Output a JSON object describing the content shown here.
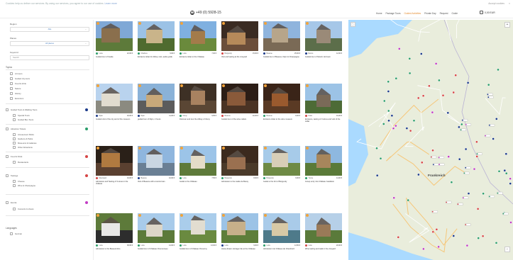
{
  "topbar": {
    "notice": "Cookies help us deliver our services. By using our services, you agree to our use of cookies.",
    "link": "Learn more",
    "right_text": "Accept cookies",
    "close": "×"
  },
  "header": {
    "phone": "+49 (0) 5928-15",
    "nav": [
      "Home",
      "Package Tours",
      "Guided Activities",
      "Private Day",
      "Request",
      "Guide"
    ],
    "nav_active_index": 2,
    "cart": "0,00 EUR"
  },
  "sidebar": {
    "region_label": "Region",
    "region_value": "Alle",
    "place_label": "Places",
    "place_value": "All places",
    "keyword_label": "Keyword",
    "keyword_placeholder": "Search",
    "topics_title": "Topics",
    "topics": [
      "Art tours",
      "Guided city tours",
      "Food & drink",
      "Nature",
      "History",
      "Excursion"
    ],
    "group_tours": "Guided Tours & Walking Tours",
    "group_tours_items": [
      "Special Tours",
      "Guided Bus Tours"
    ],
    "attractions": "Attraction Tickets",
    "attractions_items": [
      "Amusement Parks",
      "Gardens & Parks",
      "Museums & Galleries",
      "Other Attractions"
    ],
    "food": "Food & Drink",
    "food_items": [
      "Restaurants"
    ],
    "tastings": "Tastings",
    "tastings_items": [
      "Cheese",
      "Wine & Champagne"
    ],
    "events": "Events",
    "events_items": [
      "Concerts & shows"
    ],
    "languages_title": "Languages",
    "languages_items": [
      "German"
    ],
    "colors": {
      "group_dot": "#1b3a8a",
      "attract_dot": "#2a9d6a",
      "food_dot": "#d64545",
      "tast_dot": "#d64545",
      "event_dot": "#c23cc4"
    }
  },
  "cards": [
    {
      "title": "Guided tour of Castle",
      "loc": "Loire",
      "price": "22,00 €",
      "color": "#2a9d6a"
    },
    {
      "title": "Entrance ticket for Abbey visit, audio guide",
      "loc": "Chartres",
      "price": "9,00 €",
      "color": "#2a9d6a"
    },
    {
      "title": "Entrance ticket to the Château",
      "loc": "Loire",
      "price": "7,00 €",
      "color": "#2a9d6a"
    },
    {
      "title": "Visit and tasting at the vineyard",
      "loc": "Burgundy",
      "price": "15,00 €",
      "color": "#d64545"
    },
    {
      "title": "Guided tour of Beaune, Dijon & Champagne",
      "loc": "Beaune",
      "price": "25,00 €",
      "color": "#1b3a8a"
    },
    {
      "title": "Guided tour of historic old town",
      "loc": "Reims",
      "price": "12,00 €",
      "color": "#1b3a8a"
    },
    {
      "title": "Guided visit of the city and of the museum",
      "loc": "Dijon",
      "price": "18,00 €",
      "color": "#1b3a8a"
    },
    {
      "title": "guided tour of Dijon, 2 hours",
      "loc": "Dijon",
      "price": "11,00 €",
      "color": "#1b3a8a"
    },
    {
      "title": "Discover and tour the Abbey of Cluny",
      "loc": "Cluny",
      "price": "9,50 €",
      "color": "#2a9d6a"
    },
    {
      "title": "Guided tour of the wine cellars",
      "loc": "Beaune",
      "price": "22,00 €",
      "color": "#d64545"
    },
    {
      "title": "Entrance ticket to the wine museum",
      "loc": "Beaune",
      "price": "8,00 €",
      "color": "#2a9d6a"
    },
    {
      "title": "Entrance, tasting of 3 wines and visit of the cellar",
      "loc": "Nuits",
      "price": "16,00 €",
      "color": "#d64545"
    },
    {
      "title": "Admission and Tasting of 3 wines in the château",
      "loc": "Meursault",
      "price": "19,00 €",
      "color": "#d64545"
    },
    {
      "title": "Visit of Beaune with a tourist train",
      "loc": "Beaune",
      "price": "10,00 €",
      "color": "#1b3a8a"
    },
    {
      "title": "Guide to the Château",
      "loc": "Loire",
      "price": "7,50 €",
      "color": "#2a9d6a"
    },
    {
      "title": "Admission to the castle de Bussy",
      "loc": "Burgundy",
      "price": "8,00 €",
      "color": "#2a9d6a"
    },
    {
      "title": "Guide to the fort of Burgundy",
      "loc": "Burgundy",
      "price": "6,00 €",
      "color": "#2a9d6a"
    },
    {
      "title": "Group entry into Château Guédelon",
      "loc": "Yonne",
      "price": "14,00 €",
      "color": "#2a9d6a"
    },
    {
      "title": "Admission to the Beauval Zoo",
      "loc": "Loire",
      "price": "38,00 €",
      "color": "#2a9d6a"
    },
    {
      "title": "Guided tour of Château Chenonceau",
      "loc": "Loire",
      "price": "14,00 €",
      "color": "#2a9d6a"
    },
    {
      "title": "Guided tour of Château Cheverny",
      "loc": "Loire",
      "price": "13,00 €",
      "color": "#2a9d6a"
    },
    {
      "title": "Horse-drawn carriage ride at the Château",
      "loc": "Loire",
      "price": "9,00 €",
      "color": "#1b3a8a"
    },
    {
      "title": "Admission into Château de Chambord",
      "loc": "Loire",
      "price": "14,50 €",
      "color": "#2a9d6a"
    },
    {
      "title": "Wine tasting and walk in the vineyard",
      "loc": "Loire",
      "price": "20,00 €",
      "color": "#d64545"
    }
  ],
  "map": {
    "country_label": "Frankreich",
    "zoom_in": "+",
    "zoom_out": "−",
    "fullscreen": "⛶"
  }
}
